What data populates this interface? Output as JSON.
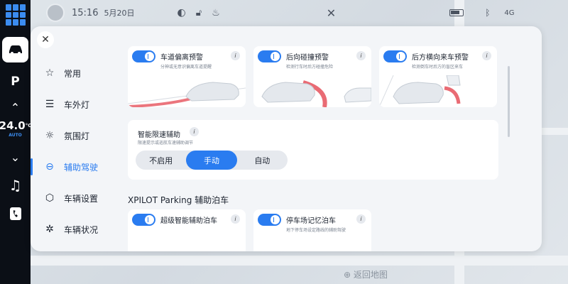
{
  "status": {
    "time": "15:16",
    "date": "5月20日",
    "network": "4G"
  },
  "rail": {
    "temperature": "24.0",
    "unit": "°C",
    "mode": "AUTO"
  },
  "menu": [
    {
      "label": "常用",
      "icon": "star-icon"
    },
    {
      "label": "车外灯",
      "icon": "headlight-icon"
    },
    {
      "label": "氛围灯",
      "icon": "ambient-light-icon"
    },
    {
      "label": "辅助驾驶",
      "icon": "steering-wheel-icon",
      "active": true
    },
    {
      "label": "车辆设置",
      "icon": "car-settings-icon"
    },
    {
      "label": "车辆状况",
      "icon": "wheel-icon"
    }
  ],
  "cards": [
    {
      "title": "车道偏离预警",
      "sub": "分神或无意识偏离车道提醒",
      "enabled": true
    },
    {
      "title": "后向碰撞预警",
      "sub": "检测行车时后方碰撞危险",
      "enabled": true
    },
    {
      "title": "后方横向来车预警",
      "sub": "检测倒车时后方的盲区来车",
      "enabled": true
    }
  ],
  "speed_assist": {
    "title": "智能限速辅助",
    "sub": "限速提示或巡航车速辅助调节",
    "options": [
      "不启用",
      "手动",
      "自动"
    ],
    "selected": "手动"
  },
  "parking": {
    "section_title": "XPILOT Parking 辅助泊车",
    "cards": [
      {
        "title": "超级智能辅助泊车",
        "enabled": true
      },
      {
        "title": "停车场记忆泊车",
        "sub": "地下停车场设定路线的辅助驾驶",
        "enabled": true
      }
    ]
  },
  "map": {
    "back_label": "返回地图"
  }
}
